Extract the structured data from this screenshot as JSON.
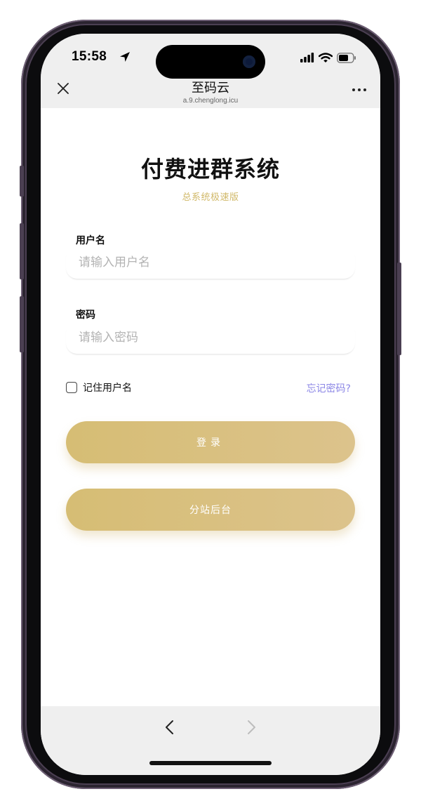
{
  "status": {
    "time": "15:58"
  },
  "browser": {
    "title": "至码云",
    "url": "a.9.chenglong.icu"
  },
  "page": {
    "heading": "付费进群系统",
    "subheading": "总系统极速版",
    "username": {
      "label": "用户名",
      "placeholder": "请输入用户名",
      "value": ""
    },
    "password": {
      "label": "密码",
      "placeholder": "请输入密码",
      "value": ""
    },
    "remember_label": "记住用户名",
    "forgot_label": "忘记密码?",
    "login_button": "登录",
    "branch_button": "分站后台"
  },
  "colors": {
    "accent_gold": "#d6bd74",
    "link_purple": "#8b86e6",
    "bar_gray": "#efefef"
  },
  "icons": {
    "close": "close-icon",
    "more": "more-dots-icon",
    "back": "chevron-left-icon",
    "forward": "chevron-right-icon",
    "location": "location-arrow-icon",
    "signal": "signal-icon",
    "wifi": "wifi-icon",
    "battery": "battery-icon"
  }
}
